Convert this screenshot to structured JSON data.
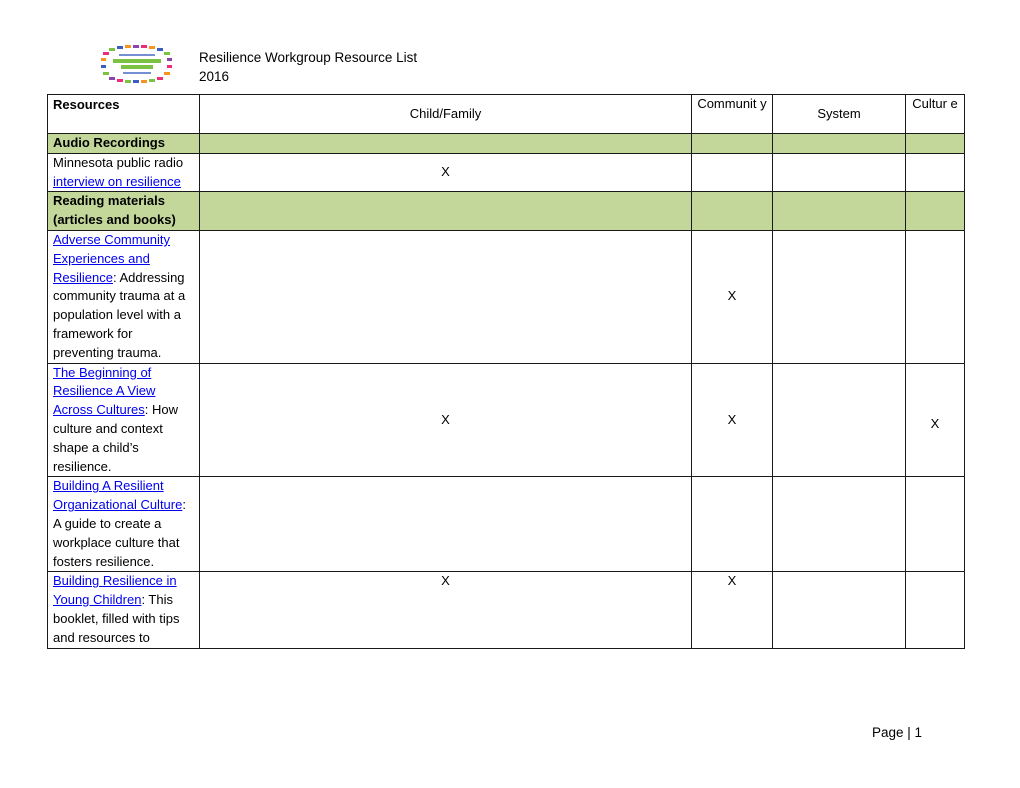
{
  "header": {
    "logo_icon": "collective-impact-logo",
    "title_line1": "Resilience Workgroup Resource List",
    "title_line2": "2016"
  },
  "table": {
    "columns": [
      "Resources",
      "Child/Family",
      "Communit y",
      "System",
      "Cultur e"
    ],
    "sections": [
      {
        "label": "Audio Recordings",
        "rows": [
          {
            "prefix": "Minnesota public radio ",
            "link": "interview on resilience",
            "desc": "",
            "child_family": "X",
            "community": "",
            "system": "",
            "culture": ""
          }
        ]
      },
      {
        "label": "Reading materials (articles and books)",
        "rows": [
          {
            "prefix": "",
            "link": "Adverse Community Experiences and Resilience",
            "desc": ": Addressing community trauma at a population level with a framework for preventing trauma.",
            "child_family": "",
            "community": "X",
            "system": "",
            "culture": ""
          },
          {
            "prefix": "",
            "link": "The Beginning of Resilience A View Across Cultures",
            "desc": ": How culture and context shape a child’s resilience.",
            "child_family": "X",
            "community": "X",
            "system": "",
            "culture": "X"
          },
          {
            "prefix": "",
            "link": "Building A Resilient Organizational Culture",
            "desc": ":  A guide to create a workplace culture that fosters resilience.",
            "child_family": "",
            "community": "",
            "system": "",
            "culture": ""
          },
          {
            "prefix": "",
            "link": "Building Resilience in Young Children",
            "desc": ":  This booklet, filled with tips and resources to",
            "child_family": "X",
            "community": "X",
            "system": "",
            "culture": ""
          }
        ]
      }
    ]
  },
  "footer": {
    "page_label": "Page | 1"
  },
  "colors": {
    "section_fill": "#c4d79b",
    "link": "#0000ee"
  }
}
